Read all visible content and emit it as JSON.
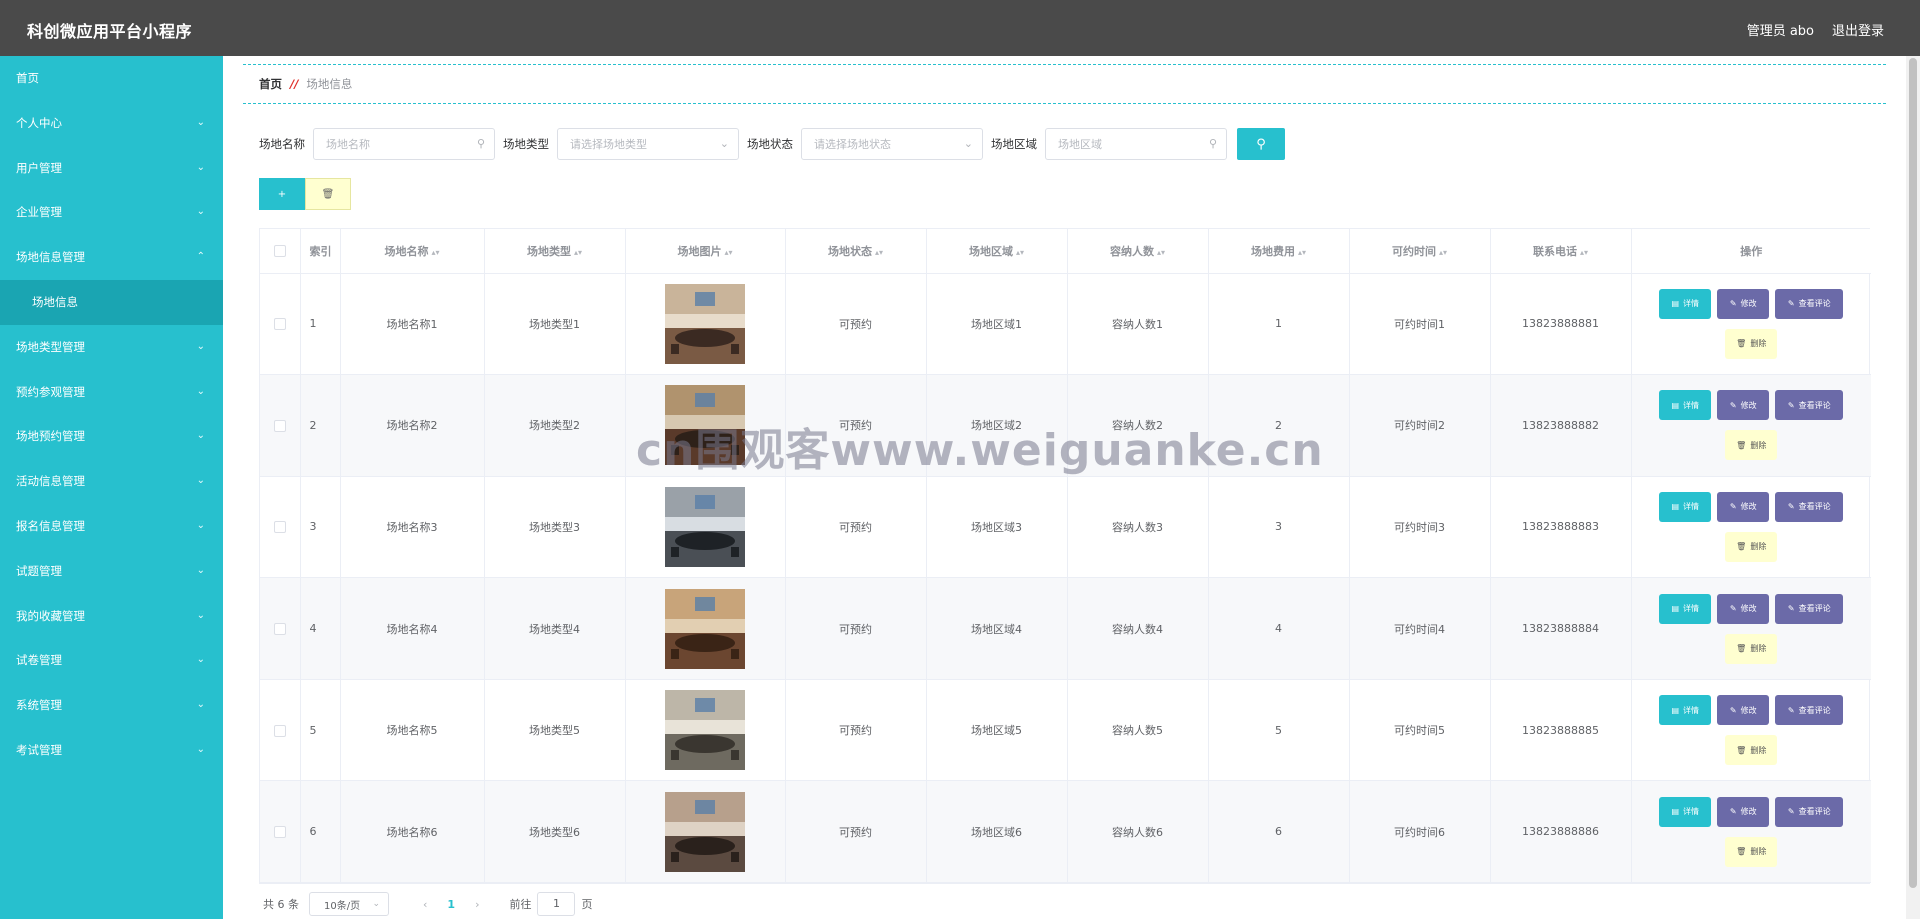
{
  "header": {
    "title": "科创微应用平台小程序",
    "admin": "管理员 abo",
    "logout": "退出登录"
  },
  "sidebar": {
    "items": [
      {
        "label": "首页",
        "chevron": ""
      },
      {
        "label": "个人中心",
        "chevron": "chevron-down-icon"
      },
      {
        "label": "用户管理",
        "chevron": "chevron-down-icon"
      },
      {
        "label": "企业管理",
        "chevron": "chevron-down-icon"
      },
      {
        "label": "场地信息管理",
        "chevron": "chevron-up-icon"
      },
      {
        "label": "场地信息",
        "chevron": ""
      },
      {
        "label": "场地类型管理",
        "chevron": "chevron-down-icon"
      },
      {
        "label": "预约参观管理",
        "chevron": "chevron-down-icon"
      },
      {
        "label": "场地预约管理",
        "chevron": "chevron-down-icon"
      },
      {
        "label": "活动信息管理",
        "chevron": "chevron-down-icon"
      },
      {
        "label": "报名信息管理",
        "chevron": "chevron-down-icon"
      },
      {
        "label": "试题管理",
        "chevron": "chevron-down-icon"
      },
      {
        "label": "我的收藏管理",
        "chevron": "chevron-down-icon"
      },
      {
        "label": "试卷管理",
        "chevron": "chevron-down-icon"
      },
      {
        "label": "系统管理",
        "chevron": "chevron-down-icon"
      },
      {
        "label": "考试管理",
        "chevron": "chevron-down-icon"
      }
    ]
  },
  "breadcrumb": {
    "home": "首页",
    "sep": "//",
    "current": "场地信息"
  },
  "search": {
    "name_label": "场地名称",
    "name_placeholder": "场地名称",
    "type_label": "场地类型",
    "type_placeholder": "请选择场地类型",
    "status_label": "场地状态",
    "status_placeholder": "请选择场地状态",
    "area_label": "场地区域",
    "area_placeholder": "场地区域"
  },
  "actions": {
    "add_icon": "+",
    "delete_icon": "trash-icon"
  },
  "table": {
    "columns": [
      "索引",
      "场地名称",
      "场地类型",
      "场地图片",
      "场地状态",
      "场地区域",
      "容纳人数",
      "场地费用",
      "可约时间",
      "联系电话",
      "操作"
    ],
    "op_labels": {
      "detail": "详情",
      "edit": "修改",
      "review": "查看评论",
      "remove": "删除"
    },
    "rows": [
      {
        "index": "1",
        "name": "场地名称1",
        "type": "场地类型1",
        "status": "可预约",
        "area": "场地区域1",
        "capacity": "容纳人数1",
        "fee": "1",
        "time": "可约时间1",
        "phone": "13823888881"
      },
      {
        "index": "2",
        "name": "场地名称2",
        "type": "场地类型2",
        "status": "可预约",
        "area": "场地区域2",
        "capacity": "容纳人数2",
        "fee": "2",
        "time": "可约时间2",
        "phone": "13823888882"
      },
      {
        "index": "3",
        "name": "场地名称3",
        "type": "场地类型3",
        "status": "可预约",
        "area": "场地区域3",
        "capacity": "容纳人数3",
        "fee": "3",
        "time": "可约时间3",
        "phone": "13823888883"
      },
      {
        "index": "4",
        "name": "场地名称4",
        "type": "场地类型4",
        "status": "可预约",
        "area": "场地区域4",
        "capacity": "容纳人数4",
        "fee": "4",
        "time": "可约时间4",
        "phone": "13823888884"
      },
      {
        "index": "5",
        "name": "场地名称5",
        "type": "场地类型5",
        "status": "可预约",
        "area": "场地区域5",
        "capacity": "容纳人数5",
        "fee": "5",
        "time": "可约时间5",
        "phone": "13823888885"
      },
      {
        "index": "6",
        "name": "场地名称6",
        "type": "场地类型6",
        "status": "可预约",
        "area": "场地区域6",
        "capacity": "容纳人数6",
        "fee": "6",
        "time": "可约时间6",
        "phone": "13823888886"
      }
    ]
  },
  "pagination": {
    "total": "共 6 条",
    "page_size": "10条/页",
    "current_page": "1",
    "goto_label": "前往",
    "goto_value": "1",
    "page_suffix": "页"
  },
  "watermark": "cn围观客www.weiguanke.cn",
  "colors": {
    "accent": "#27c0ce",
    "topbar": "#4a4a4a",
    "purple_button": "#6b6aa8",
    "yellow_button": "#ffffd0"
  }
}
